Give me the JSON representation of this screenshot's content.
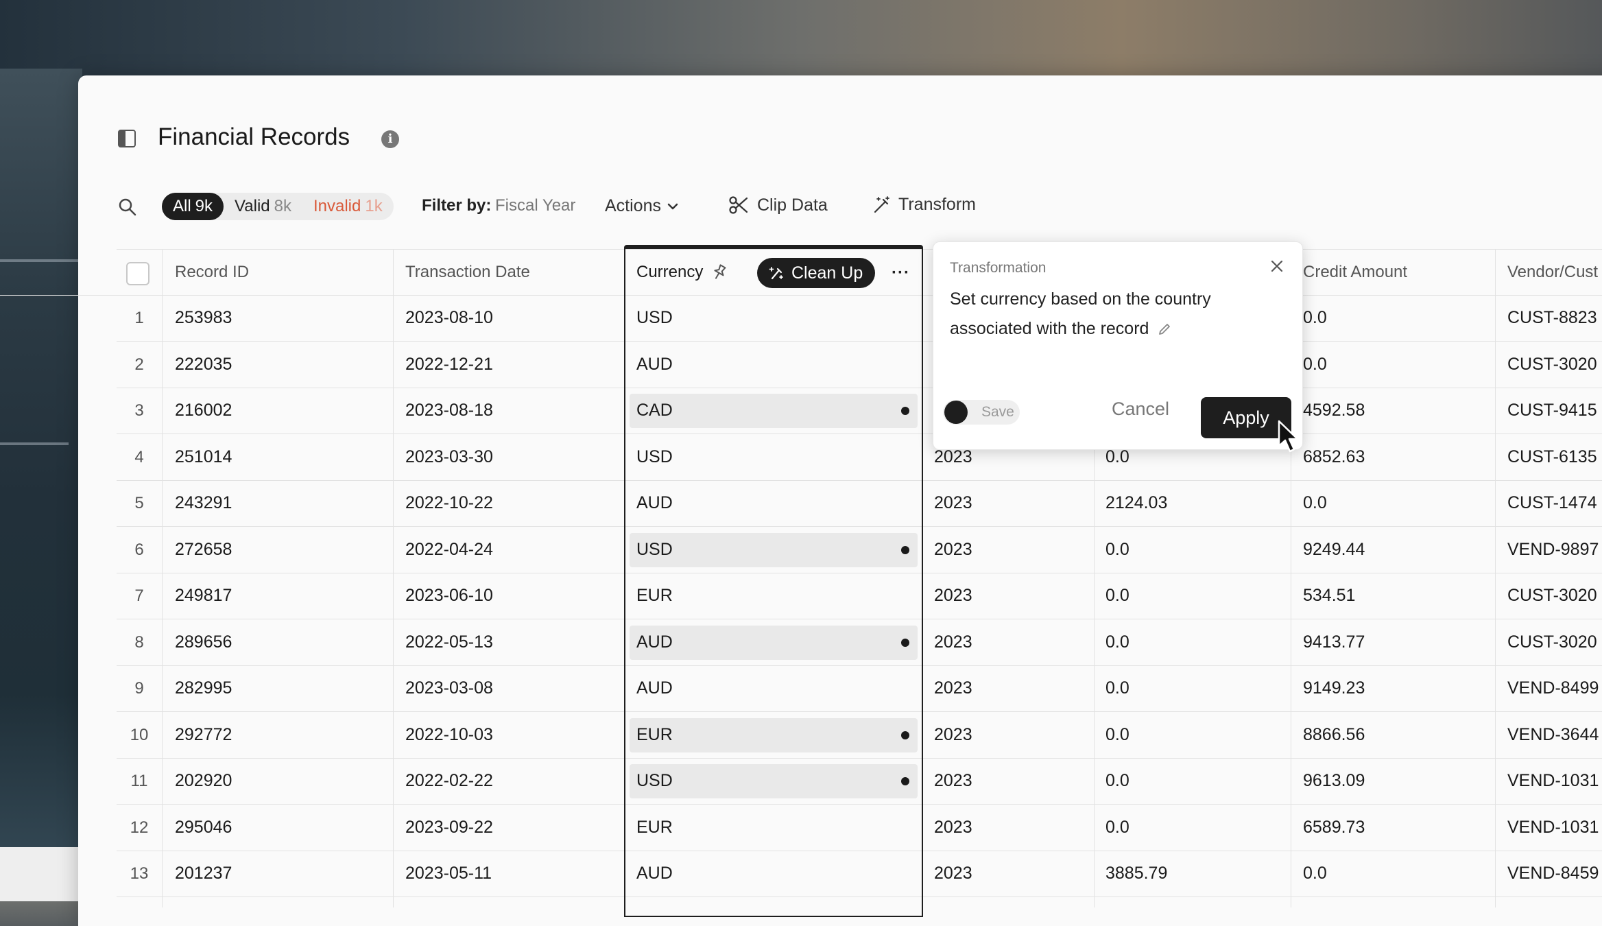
{
  "page": {
    "title": "Financial Records"
  },
  "toolbar": {
    "segments": [
      {
        "label": "All",
        "count": "9k"
      },
      {
        "label": "Valid",
        "count": "8k"
      },
      {
        "label": "Invalid",
        "count": "1k"
      }
    ],
    "filter_label": "Filter by:",
    "filter_value": "Fiscal Year",
    "actions_label": "Actions",
    "clip_label": "Clip Data",
    "transform_label": "Transform"
  },
  "table": {
    "columns": [
      "Record ID",
      "Transaction Date",
      "Currency",
      "",
      "",
      "Credit Amount",
      "Vendor/Cust"
    ],
    "cleanup_label": "Clean Up",
    "more_label": "···",
    "rows": [
      {
        "n": "1",
        "id": "253983",
        "date": "2023-08-10",
        "cur": "USD",
        "hl": false,
        "fy": "",
        "debit": "",
        "credit": "0.0",
        "vendor": "CUST-8823"
      },
      {
        "n": "2",
        "id": "222035",
        "date": "2022-12-21",
        "cur": "AUD",
        "hl": false,
        "fy": "",
        "debit": "",
        "credit": "0.0",
        "vendor": "CUST-3020"
      },
      {
        "n": "3",
        "id": "216002",
        "date": "2023-08-18",
        "cur": "CAD",
        "hl": true,
        "fy": "",
        "debit": "",
        "credit": "4592.58",
        "vendor": "CUST-9415"
      },
      {
        "n": "4",
        "id": "251014",
        "date": "2023-03-30",
        "cur": "USD",
        "hl": false,
        "fy": "2023",
        "debit": "0.0",
        "credit": "6852.63",
        "vendor": "CUST-6135"
      },
      {
        "n": "5",
        "id": "243291",
        "date": "2022-10-22",
        "cur": "AUD",
        "hl": false,
        "fy": "2023",
        "debit": "2124.03",
        "credit": "0.0",
        "vendor": "CUST-1474"
      },
      {
        "n": "6",
        "id": "272658",
        "date": "2022-04-24",
        "cur": "USD",
        "hl": true,
        "fy": "2023",
        "debit": "0.0",
        "credit": "9249.44",
        "vendor": "VEND-9897"
      },
      {
        "n": "7",
        "id": "249817",
        "date": "2023-06-10",
        "cur": "EUR",
        "hl": false,
        "fy": "2023",
        "debit": "0.0",
        "credit": "534.51",
        "vendor": "CUST-3020"
      },
      {
        "n": "8",
        "id": "289656",
        "date": "2022-05-13",
        "cur": "AUD",
        "hl": true,
        "fy": "2023",
        "debit": "0.0",
        "credit": "9413.77",
        "vendor": "CUST-3020"
      },
      {
        "n": "9",
        "id": "282995",
        "date": "2023-03-08",
        "cur": "AUD",
        "hl": false,
        "fy": "2023",
        "debit": "0.0",
        "credit": "9149.23",
        "vendor": "VEND-8499"
      },
      {
        "n": "10",
        "id": "292772",
        "date": "2022-10-03",
        "cur": "EUR",
        "hl": true,
        "fy": "2023",
        "debit": "0.0",
        "credit": "8866.56",
        "vendor": "VEND-3644"
      },
      {
        "n": "11",
        "id": "202920",
        "date": "2022-02-22",
        "cur": "USD",
        "hl": true,
        "fy": "2023",
        "debit": "0.0",
        "credit": "9613.09",
        "vendor": "VEND-1031"
      },
      {
        "n": "12",
        "id": "295046",
        "date": "2023-09-22",
        "cur": "EUR",
        "hl": false,
        "fy": "2023",
        "debit": "0.0",
        "credit": "6589.73",
        "vendor": "VEND-1031"
      },
      {
        "n": "13",
        "id": "201237",
        "date": "2023-05-11",
        "cur": "AUD",
        "hl": false,
        "fy": "2023",
        "debit": "3885.79",
        "credit": "0.0",
        "vendor": "VEND-8459"
      }
    ]
  },
  "popover": {
    "title": "Transformation",
    "text": "Set currency based on the country associated with the record",
    "save_label": "Save",
    "cancel_label": "Cancel",
    "apply_label": "Apply"
  },
  "colors": {
    "accent": "#1e1e1e",
    "invalid": "#d95a3a"
  }
}
